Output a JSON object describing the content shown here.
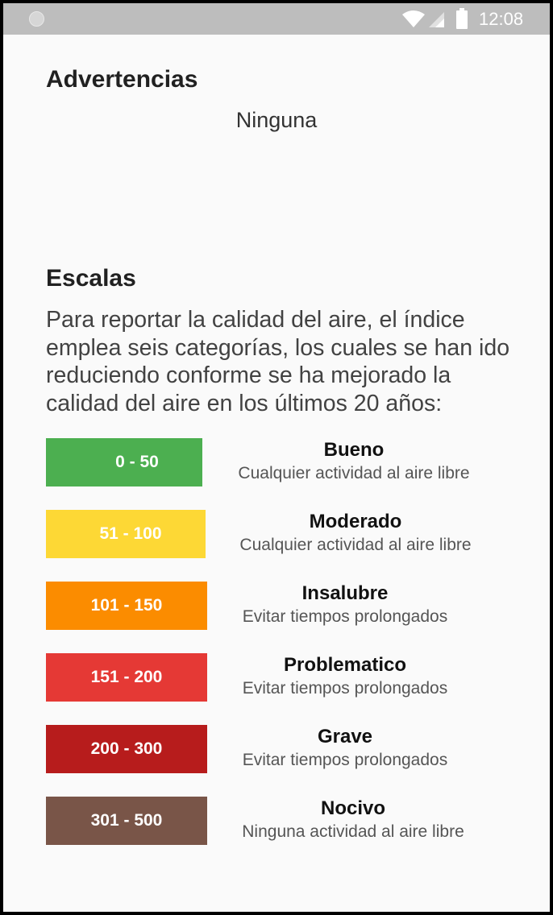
{
  "status_bar": {
    "time": "12:08"
  },
  "warnings": {
    "title": "Advertencias",
    "value": "Ninguna"
  },
  "scales": {
    "title": "Escalas",
    "description": "Para reportar la calidad del aire, el índice emplea seis categorías, los cuales se han ido reduciendo conforme se ha mejorado la calidad del aire en los últimos 20 años:",
    "items": [
      {
        "range": "0 - 50",
        "name": "Bueno",
        "advice": "Cualquier actividad al aire libre",
        "color": "#4caf50"
      },
      {
        "range": "51 - 100",
        "name": "Moderado",
        "advice": "Cualquier actividad al aire libre",
        "color": "#fdd835"
      },
      {
        "range": "101 - 150",
        "name": "Insalubre",
        "advice": "Evitar tiempos prolongados",
        "color": "#fb8c00"
      },
      {
        "range": "151 - 200",
        "name": "Problematico",
        "advice": "Evitar tiempos prolongados",
        "color": "#e53935"
      },
      {
        "range": "200 - 300",
        "name": "Grave",
        "advice": "Evitar tiempos prolongados",
        "color": "#b71c1c"
      },
      {
        "range": "301 - 500",
        "name": "Nocivo",
        "advice": "Ninguna actividad al aire libre",
        "color": "#795548"
      }
    ]
  }
}
